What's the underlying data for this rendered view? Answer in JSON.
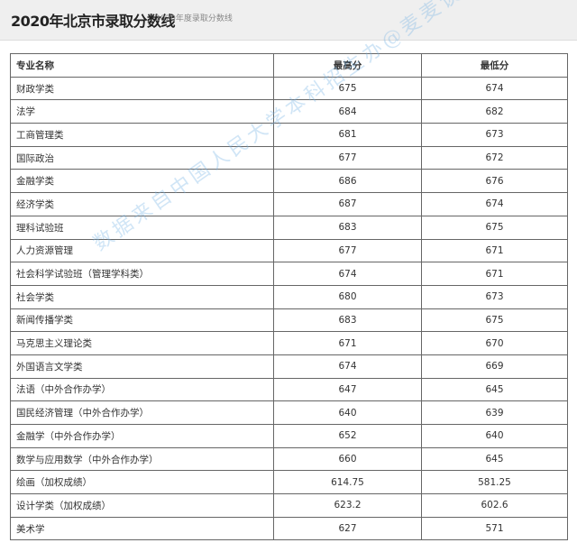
{
  "header": {
    "title": "2020年北京市录取分数线",
    "subtitle": "2020年度录取分数线"
  },
  "table": {
    "columns": [
      "专业名称",
      "最高分",
      "最低分"
    ],
    "rows": [
      [
        "财政学类",
        "675",
        "674"
      ],
      [
        "法学",
        "684",
        "682"
      ],
      [
        "工商管理类",
        "681",
        "673"
      ],
      [
        "国际政治",
        "677",
        "672"
      ],
      [
        "金融学类",
        "686",
        "676"
      ],
      [
        "经济学类",
        "687",
        "674"
      ],
      [
        "理科试验班",
        "683",
        "675"
      ],
      [
        "人力资源管理",
        "677",
        "671"
      ],
      [
        "社会科学试验班（管理学科类）",
        "674",
        "671"
      ],
      [
        "社会学类",
        "680",
        "673"
      ],
      [
        "新闻传播学类",
        "683",
        "675"
      ],
      [
        "马克思主义理论类",
        "671",
        "670"
      ],
      [
        "外国语言文学类",
        "674",
        "669"
      ],
      [
        "法语（中外合作办学）",
        "647",
        "645"
      ],
      [
        "国民经济管理（中外合作办学）",
        "640",
        "639"
      ],
      [
        "金融学（中外合作办学）",
        "652",
        "640"
      ],
      [
        "数学与应用数学（中外合作办学）",
        "660",
        "645"
      ],
      [
        "绘画（加权成绩）",
        "614.75",
        "581.25"
      ],
      [
        "设计学类（加权成绩）",
        "623.2",
        "602.6"
      ],
      [
        "美术学",
        "627",
        "571"
      ]
    ]
  },
  "watermark": "数据来自中国人民大学本科招生办@麦麦谈教育整理"
}
